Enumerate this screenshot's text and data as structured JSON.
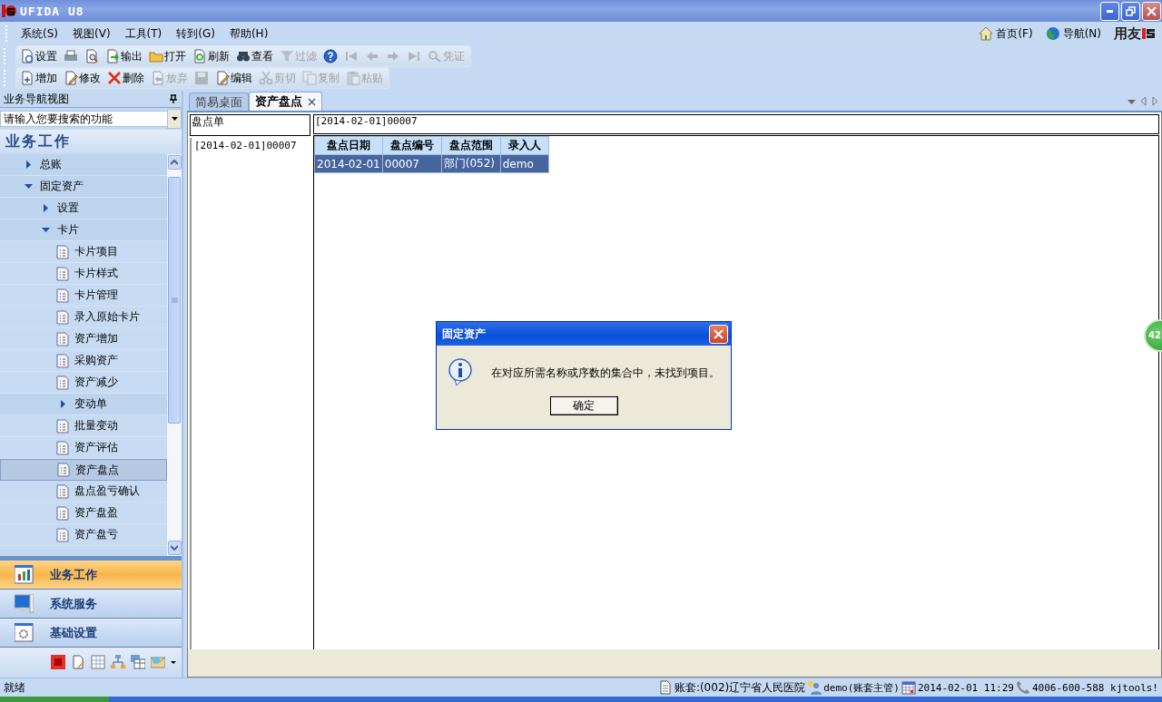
{
  "window": {
    "title": "UFIDA U8"
  },
  "menu": [
    {
      "label": "系统(S)"
    },
    {
      "label": "视图(V)"
    },
    {
      "label": "工具(T)"
    },
    {
      "label": "转到(G)"
    },
    {
      "label": "帮助(H)"
    }
  ],
  "top_links": [
    {
      "label": "首页(F)"
    },
    {
      "label": "导航(N)"
    }
  ],
  "brand": "用友",
  "toolbars": [
    [
      {
        "label": "设置",
        "disabled": false
      },
      {
        "disabled": false
      },
      {
        "disabled": false
      },
      {
        "label": "输出",
        "disabled": false
      },
      {
        "label": "打开",
        "disabled": false
      },
      {
        "label": "刷新",
        "disabled": false
      },
      {
        "label": "查看",
        "disabled": false
      },
      {
        "label": "过滤",
        "disabled": true
      },
      {
        "disabled": false
      },
      {
        "disabled": true
      },
      {
        "disabled": true
      },
      {
        "disabled": true
      },
      {
        "disabled": true
      },
      {
        "label": "凭证",
        "disabled": true
      }
    ],
    [
      {
        "label": "增加",
        "disabled": false
      },
      {
        "label": "修改",
        "disabled": false
      },
      {
        "label": "删除",
        "disabled": false
      },
      {
        "label": "放弃",
        "disabled": true
      },
      {
        "disabled": true
      },
      {
        "label": "编辑",
        "disabled": false
      },
      {
        "label": "剪切",
        "disabled": true
      },
      {
        "label": "复制",
        "disabled": true
      },
      {
        "label": "粘贴",
        "disabled": true
      }
    ]
  ],
  "nav_panel": {
    "title": "业务导航视图",
    "search": {
      "placeholder": "请输入您要搜索的功能"
    },
    "section": "业务工作",
    "tree": [
      {
        "label": "总账",
        "expanded": false,
        "selected": false
      },
      {
        "label": "固定资产",
        "expanded": true,
        "selected": false,
        "children": [
          {
            "label": "设置",
            "expanded": false,
            "selected": false
          },
          {
            "label": "卡片",
            "expanded": true,
            "selected": false,
            "children": [
              {
                "label": "卡片项目",
                "selected": false
              },
              {
                "label": "卡片样式",
                "selected": false
              },
              {
                "label": "卡片管理",
                "selected": false
              },
              {
                "label": "录入原始卡片",
                "selected": false
              },
              {
                "label": "资产增加",
                "selected": false
              },
              {
                "label": "采购资产",
                "selected": false
              },
              {
                "label": "资产减少",
                "selected": false
              },
              {
                "label": "变动单",
                "expanded": false,
                "selected": false
              },
              {
                "label": "批量变动",
                "selected": false
              },
              {
                "label": "资产评估",
                "selected": false
              },
              {
                "label": "资产盘点",
                "selected": true
              },
              {
                "label": "盘点盈亏确认",
                "selected": false
              },
              {
                "label": "资产盘盈",
                "selected": false
              },
              {
                "label": "资产盘亏",
                "selected": false
              }
            ]
          }
        ]
      }
    ]
  },
  "nav_buttons": [
    {
      "label": "业务工作",
      "selected": true
    },
    {
      "label": "系统服务",
      "selected": false
    },
    {
      "label": "基础设置",
      "selected": false
    }
  ],
  "tabs": [
    {
      "label": "简易桌面",
      "selected": false,
      "closable": false
    },
    {
      "label": "资产盘点",
      "selected": true,
      "closable": true
    }
  ],
  "document_list": {
    "title": "盘点单",
    "items": [
      {
        "label": "[2014-02-01]00007"
      }
    ]
  },
  "document": {
    "title": "[2014-02-01]00007",
    "table": {
      "columns": [
        "盘点日期",
        "盘点编号",
        "盘点范围",
        "录入人"
      ],
      "rows": [
        {
          "cells": [
            "2014-02-01",
            "00007",
            "部门(052)",
            "demo"
          ],
          "selected": true
        }
      ]
    }
  },
  "dialog": {
    "title": "固定资产",
    "message": "在对应所需名称或序数的集合中，未找到项目。",
    "button": "确定"
  },
  "badge": "42",
  "status_bar": {
    "message": "就绪",
    "account": "账套:(002)辽宁省人民医院",
    "user": "demo(账套主管)",
    "date": "2014-02-01 11:29",
    "phone": "4006-600-588 kjtools!"
  }
}
